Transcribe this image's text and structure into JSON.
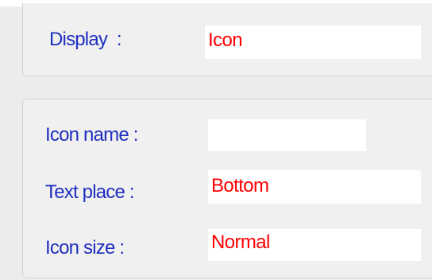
{
  "display_group": {
    "label": "Display  :",
    "value": "Icon"
  },
  "icon_group": {
    "icon_name": {
      "label": "Icon name :",
      "value": ""
    },
    "text_place": {
      "label": "Text place :",
      "value": "Bottom"
    },
    "icon_size": {
      "label": "Icon size :",
      "value": "Normal"
    }
  },
  "colors": {
    "label": "#1f2fbf",
    "value": "#ff0000",
    "panel": "#f0f0f0",
    "border": "#cfd6df"
  }
}
